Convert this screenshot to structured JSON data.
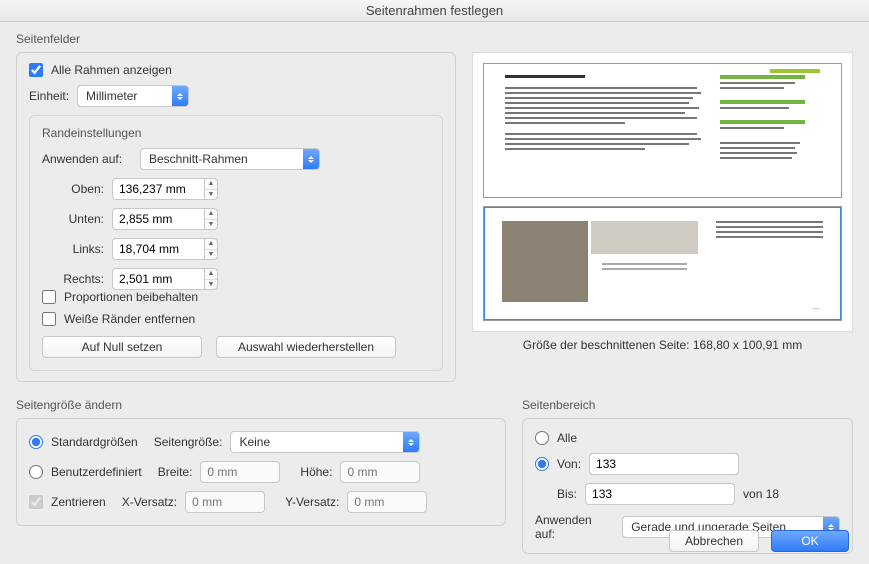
{
  "title": "Seitenrahmen festlegen",
  "seitenfelder": {
    "label": "Seitenfelder",
    "show_all_frames": "Alle Rahmen anzeigen",
    "unit_label": "Einheit:",
    "unit_value": "Millimeter",
    "margin": {
      "title": "Randeinstellungen",
      "apply_to_label": "Anwenden auf:",
      "apply_to_value": "Beschnitt-Rahmen",
      "top_label": "Oben:",
      "top_value": "136,237 mm",
      "bottom_label": "Unten:",
      "bottom_value": "2,855 mm",
      "left_label": "Links:",
      "left_value": "18,704 mm",
      "right_label": "Rechts:",
      "right_value": "2,501 mm",
      "keep_proportions": "Proportionen beibehalten",
      "remove_white": "Weiße Ränder entfernen",
      "reset_btn": "Auf Null setzen",
      "restore_btn": "Auswahl wiederherstellen"
    },
    "cropped_size": "Größe der beschnittenen Seite: 168,80 x 100,91 mm"
  },
  "resize": {
    "title": "Seitengröße ändern",
    "standard": "Standardgrößen",
    "pagesize_label": "Seitengröße:",
    "pagesize_value": "Keine",
    "custom": "Benutzerdefiniert",
    "width_label": "Breite:",
    "width_ph": "0 mm",
    "height_label": "Höhe:",
    "height_ph": "0 mm",
    "center": "Zentrieren",
    "xoff_label": "X-Versatz:",
    "xoff_ph": "0 mm",
    "yoff_label": "Y-Versatz:",
    "yoff_ph": "0 mm"
  },
  "range": {
    "title": "Seitenbereich",
    "all": "Alle",
    "from": "Von:",
    "from_value": "133",
    "to": "Bis:",
    "to_value": "133",
    "of": "von 18",
    "apply_to_label": "Anwenden auf:",
    "apply_to_value": "Gerade und ungerade Seiten"
  },
  "buttons": {
    "cancel": "Abbrechen",
    "ok": "OK"
  }
}
